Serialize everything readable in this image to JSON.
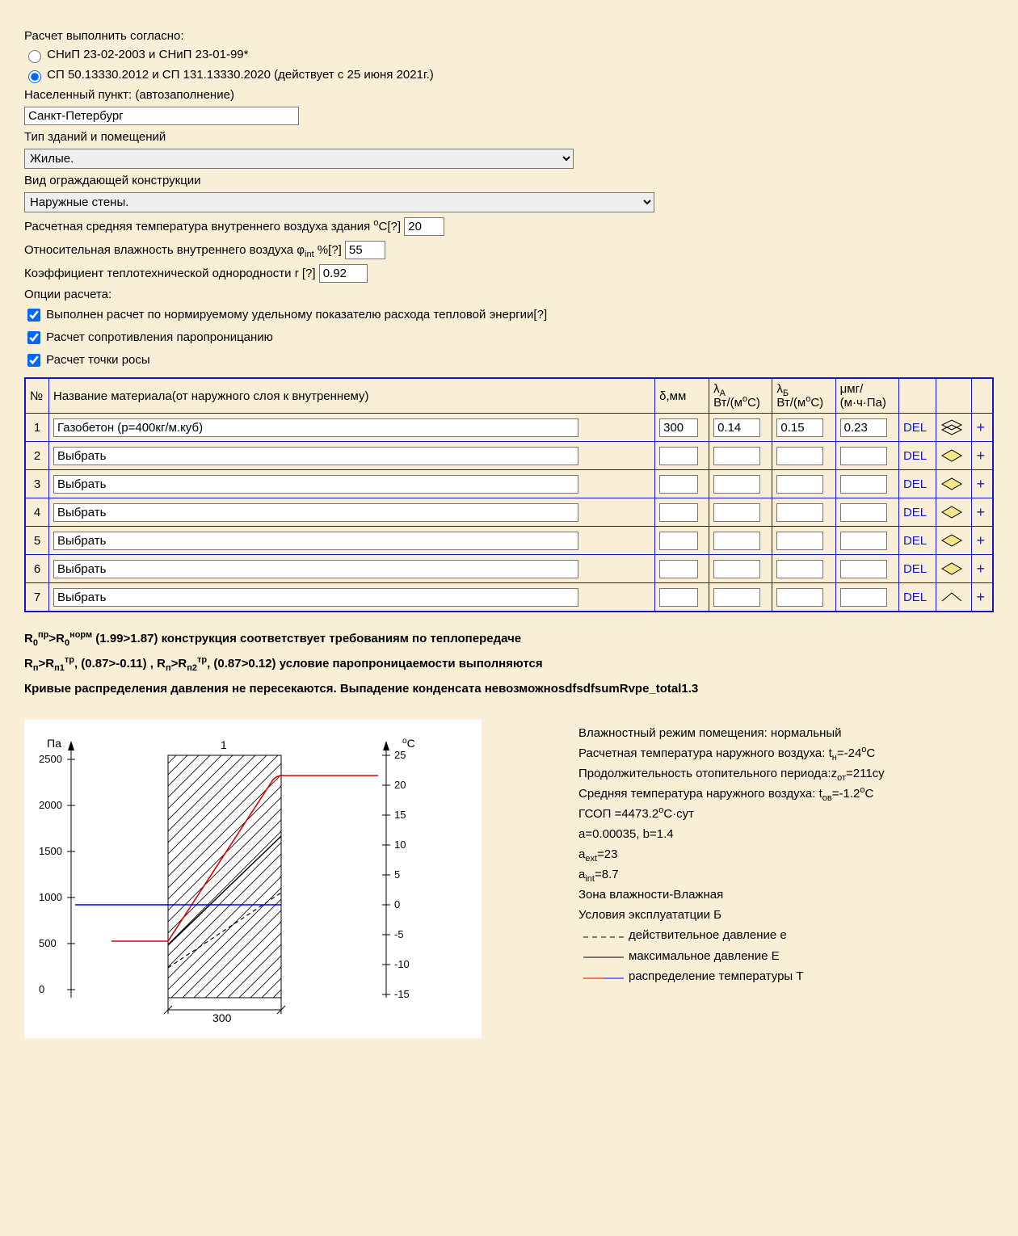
{
  "header": "Расчет выполнить согласно:",
  "radio1": "СНиП 23-02-2003 и СНиП 23-01-99*",
  "radio2": "СП 50.13330.2012 и СП 131.13330.2020 (действует с 25 июня 2021г.)",
  "city_label": "Населенный пункт: (автозаполнение)",
  "city_value": "Санкт-Петербург",
  "building_label": "Тип зданий и помещений",
  "building_value": "Жилые.",
  "envelope_label": "Вид ограждающей конструкции",
  "envelope_value": "Наружные стены.",
  "temp_label_a": "Расчетная средняя температура внутреннего воздуха здания ",
  "temp_label_b": "C[",
  "temp_label_c": "?",
  "temp_label_d": "]",
  "temp_value": "20",
  "hum_label_a": "Относительная влажность внутреннего воздуха φ",
  "hum_label_b": " %[",
  "hum_label_c": "?",
  "hum_label_d": "]",
  "hum_value": "55",
  "r_label_a": "Коэффициент теплотехнической однородности r [",
  "r_label_b": "?",
  "r_label_c": "]",
  "r_value": "0.92",
  "options_label": "Опции расчета:",
  "opt1_a": "Выполнен расчет по нормируемому удельному показателю расхода тепловой энергии[",
  "opt1_b": "?",
  "opt1_c": "]",
  "opt2": "Расчет сопротивления паропроницанию",
  "opt3": "Расчет точки росы",
  "th_num": "№",
  "th_name": "Название материала(от наружного слоя к внутреннему)",
  "th_delta": "δ,мм",
  "th_lamA_a": "λ",
  "th_lamA_b": "А",
  "th_lam_unit": "Вт/(м",
  "th_lam_unit2": "С)",
  "th_lamB_a": "λ",
  "th_lamB_b": "Б",
  "th_mu_a": "μмг/",
  "th_mu_b": "(м·ч·Па)",
  "rows": [
    {
      "n": "1",
      "name": "Газобетон (p=400кг/м.куб)",
      "d": "300",
      "la": "0.14",
      "lb": "0.15",
      "mu": "0.23"
    },
    {
      "n": "2",
      "name": "Выбрать",
      "d": "",
      "la": "",
      "lb": "",
      "mu": ""
    },
    {
      "n": "3",
      "name": "Выбрать",
      "d": "",
      "la": "",
      "lb": "",
      "mu": ""
    },
    {
      "n": "4",
      "name": "Выбрать",
      "d": "",
      "la": "",
      "lb": "",
      "mu": ""
    },
    {
      "n": "5",
      "name": "Выбрать",
      "d": "",
      "la": "",
      "lb": "",
      "mu": ""
    },
    {
      "n": "6",
      "name": "Выбрать",
      "d": "",
      "la": "",
      "lb": "",
      "mu": ""
    },
    {
      "n": "7",
      "name": "Выбрать",
      "d": "",
      "la": "",
      "lb": "",
      "mu": ""
    }
  ],
  "del": "DEL",
  "plus": "+",
  "res1_a": "R",
  "res1_b": "0",
  "res1_c": "пр",
  "res1_d": ">R",
  "res1_e": "0",
  "res1_f": "норм",
  "res1_g": " (1.99>1.87) конструкция соответствует требованиям по теплопередаче",
  "res2_a": "R",
  "res2_b": "п",
  "res2_c": ">R",
  "res2_d": "п1",
  "res2_e": "тр",
  "res2_f": ", (0.87>-0.11) , R",
  "res2_g": "п",
  "res2_h": ">R",
  "res2_i": "п2",
  "res2_j": "тр",
  "res2_k": ", (0.87>0.12) условие паропроницаемости выполняются",
  "res3": "Кривые распределения давления не пересекаются. Выпадение конденсата невозможноsdfsdfsumRvpe_total1.3",
  "chart_pa": "Па",
  "chart_degc": "С",
  "chart_layer": "1",
  "chart_dim": "300",
  "y_left": [
    "2500",
    "2000",
    "1500",
    "1000",
    "500",
    "0"
  ],
  "y_right": [
    "25",
    "20",
    "15",
    "10",
    "5",
    "0",
    "-5",
    "-10",
    "-15"
  ],
  "info": {
    "l1_a": "Влажностный режим помещения: нормальный",
    "l2_a": "Расчетная температура наружного воздуха: t",
    "l2_b": "н",
    "l2_c": "=-24",
    "l2_d": "C",
    "l3_a": "Продолжительность отопительного периода:z",
    "l3_b": "от",
    "l3_c": "=211су",
    "l4_a": "Средняя температура наружного воздуха: t",
    "l4_b": "ов",
    "l4_c": "=-1.2",
    "l4_d": "C",
    "l5_a": "ГСОП =4473.2",
    "l5_b": "С·сут",
    "l6": "a=0.00035, b=1.4",
    "l7_a": "a",
    "l7_b": "ext",
    "l7_c": "=23",
    "l8_a": "a",
    "l8_b": "int",
    "l8_c": "=8.7",
    "l9": "Зона влажности-Влажная",
    "l10": "Условия эксплуататции Б",
    "leg1": "действительное давление e",
    "leg2": "максимальное давление E",
    "leg3": "распределение температуры T"
  },
  "chart_data": {
    "type": "line",
    "layers": [
      {
        "name": "Газобетон",
        "thickness_mm": 300
      }
    ],
    "left_axis": {
      "label": "Па",
      "range": [
        0,
        2700
      ]
    },
    "right_axis": {
      "label": "°C",
      "range": [
        -17,
        25
      ]
    },
    "series": [
      {
        "name": "e (действительное давление)",
        "style": "dashed",
        "color": "#000",
        "points": [
          [
            0,
            380
          ],
          [
            300,
            1230
          ]
        ]
      },
      {
        "name": "E (максимальное давление)",
        "style": "solid",
        "color": "#000",
        "points": [
          [
            0,
            620
          ],
          [
            300,
            1880
          ]
        ]
      },
      {
        "name": "T (температура)",
        "style": "solid",
        "color": "red->blue",
        "left_const_C": -11,
        "inside": [
          [
            0,
            -11
          ],
          [
            300,
            20
          ]
        ],
        "right_const_C": 20,
        "mapped_Pa_equiv": [
          [
            -60,
            660
          ],
          [
            0,
            660
          ],
          [
            300,
            2530
          ],
          [
            420,
            2530
          ]
        ],
        "blue_segment": [
          [
            -60,
            1075
          ],
          [
            300,
            1075
          ]
        ]
      }
    ]
  }
}
